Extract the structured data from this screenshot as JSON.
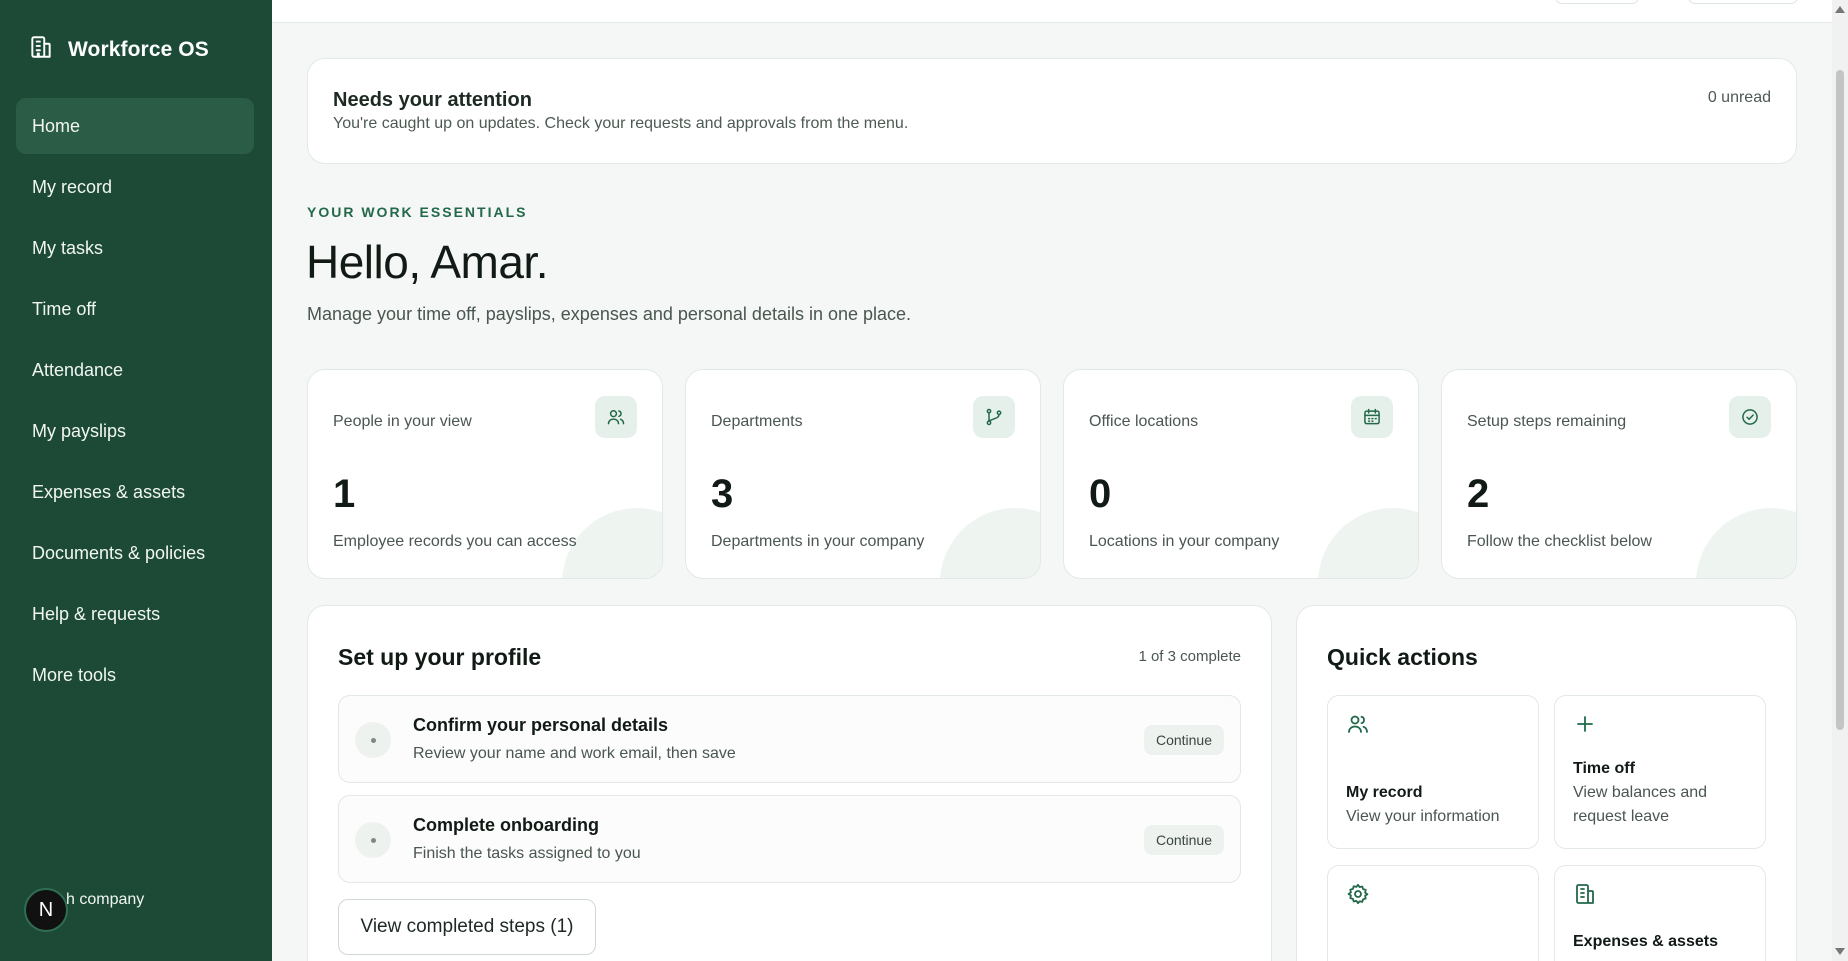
{
  "app": {
    "name": "Workforce OS"
  },
  "sidebar": {
    "items": [
      {
        "label": "Home",
        "active": true
      },
      {
        "label": "My record"
      },
      {
        "label": "My tasks"
      },
      {
        "label": "Time off"
      },
      {
        "label": "Attendance"
      },
      {
        "label": "My payslips"
      },
      {
        "label": "Expenses & assets"
      },
      {
        "label": "Documents & policies"
      },
      {
        "label": "Help & requests"
      },
      {
        "label": "More tools"
      }
    ],
    "avatar_initial": "N",
    "company_label": "h company"
  },
  "attention": {
    "title": "Needs your attention",
    "description": "You're caught up on updates. Check your requests and approvals from the menu.",
    "unread": "0 unread"
  },
  "hero": {
    "eyebrow": "YOUR WORK ESSENTIALS",
    "greeting": "Hello, Amar.",
    "subtitle": "Manage your time off, payslips, expenses and personal details in one place."
  },
  "stats": [
    {
      "label": "People in your view",
      "value": "1",
      "caption": "Employee records you can access",
      "icon": "people-icon"
    },
    {
      "label": "Departments",
      "value": "3",
      "caption": "Departments in your company",
      "icon": "branch-icon"
    },
    {
      "label": "Office locations",
      "value": "0",
      "caption": "Locations in your company",
      "icon": "calendar-icon"
    },
    {
      "label": "Setup steps remaining",
      "value": "2",
      "caption": "Follow the checklist below",
      "icon": "check-circle-icon"
    }
  ],
  "setup": {
    "title": "Set up your profile",
    "progress": "1 of 3 complete",
    "steps": [
      {
        "title": "Confirm your personal details",
        "description": "Review your name and work email, then save",
        "action": "Continue"
      },
      {
        "title": "Complete onboarding",
        "description": "Finish the tasks assigned to you",
        "action": "Continue"
      }
    ],
    "completed_button": "View completed steps (1)"
  },
  "quick_actions": {
    "title": "Quick actions",
    "items": [
      {
        "title": "My record",
        "description": "View your information",
        "icon": "people-icon"
      },
      {
        "title": "Time off",
        "description": "View balances and request leave",
        "icon": "plus-icon"
      },
      {
        "title": "",
        "description": "",
        "icon": "gear-icon"
      },
      {
        "title": "Expenses & assets",
        "description": "",
        "icon": "building-icon"
      }
    ]
  },
  "colors": {
    "sidebar": "#1c4a36",
    "sidebar_active": "#2b5c46",
    "accent": "#23684a",
    "icon_bg": "#e6f0eb"
  }
}
